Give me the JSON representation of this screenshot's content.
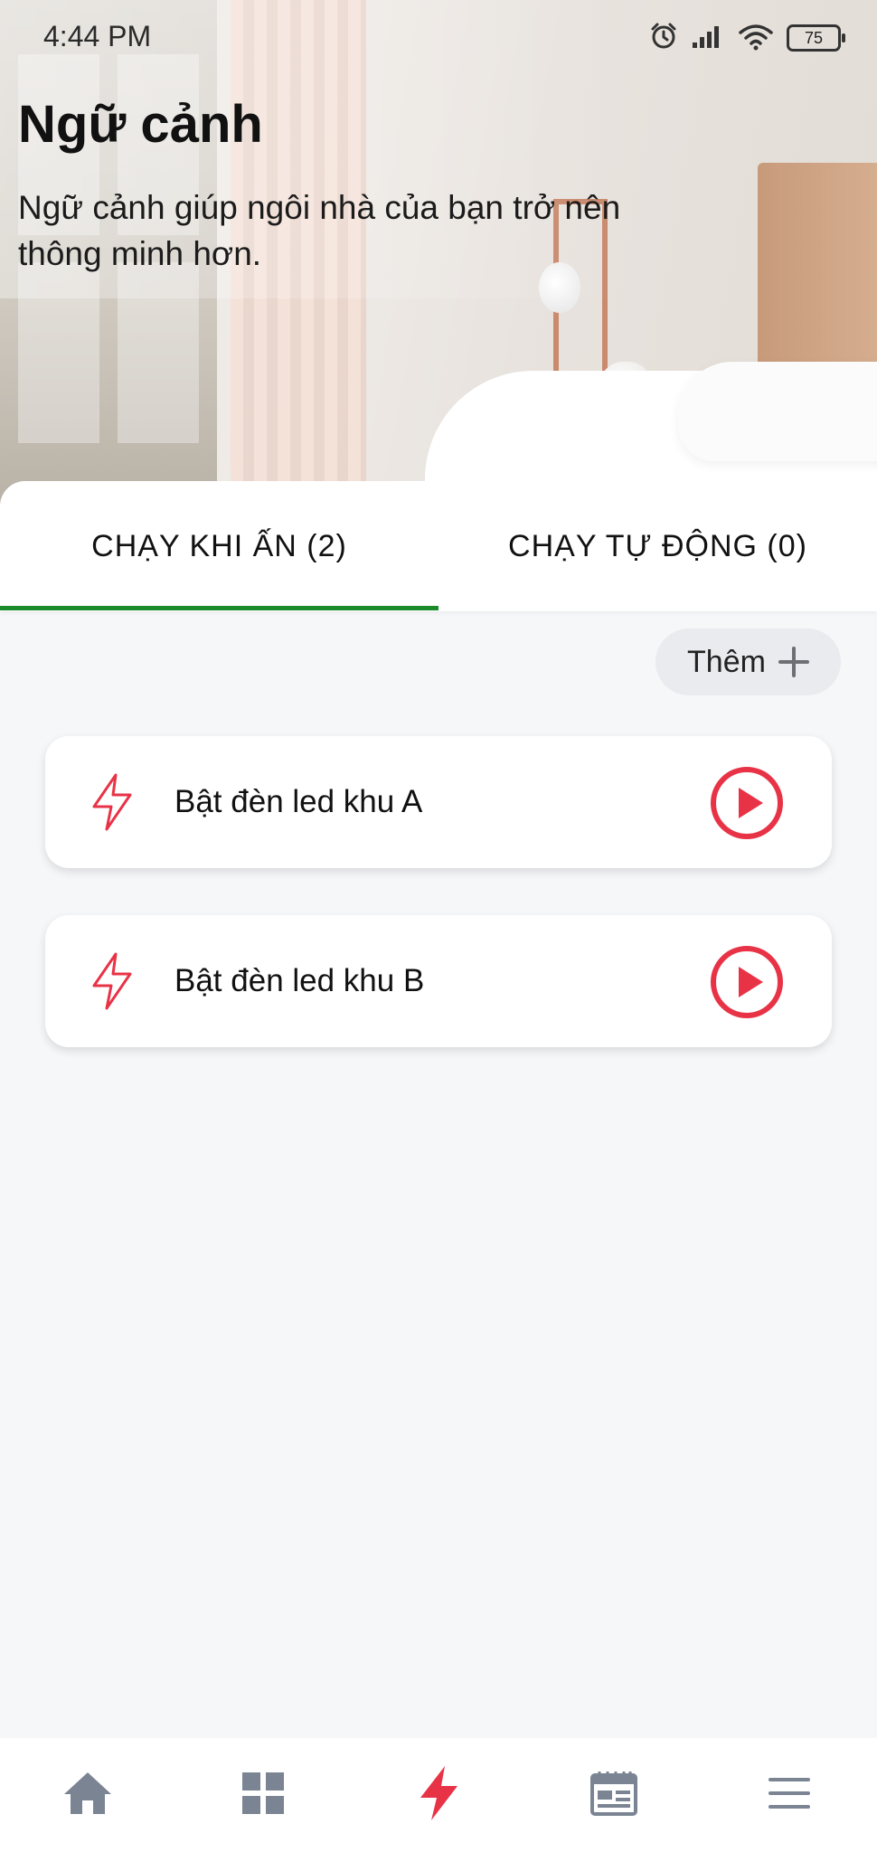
{
  "status_bar": {
    "time": "4:44 PM",
    "battery": "75",
    "icons": [
      "alarm-icon",
      "signal-icon",
      "wifi-icon",
      "battery-icon"
    ]
  },
  "header": {
    "title": "Ngữ cảnh",
    "subtitle": "Ngữ cảnh giúp ngôi nhà của bạn trở nên thông minh hơn."
  },
  "tabs": [
    {
      "label": "CHẠY KHI ẤN (2)",
      "active": true
    },
    {
      "label": "CHẠY TỰ ĐỘNG (0)",
      "active": false
    }
  ],
  "add_button": {
    "label": "Thêm",
    "icon": "plus-icon"
  },
  "scenes": [
    {
      "name": "Bật đèn led khu A",
      "icon": "lightning-icon",
      "action_icon": "play-icon"
    },
    {
      "name": "Bật đèn led khu B",
      "icon": "lightning-icon",
      "action_icon": "play-icon"
    }
  ],
  "bottom_nav": [
    {
      "icon": "home-icon",
      "active": false
    },
    {
      "icon": "grid-icon",
      "active": false
    },
    {
      "icon": "lightning-icon",
      "active": true
    },
    {
      "icon": "calendar-icon",
      "active": false
    },
    {
      "icon": "menu-icon",
      "active": false
    }
  ],
  "colors": {
    "accent": "#e83347",
    "tab_indicator": "#1a8a2a",
    "nav_inactive": "#7b8492",
    "background": "#f6f7f9"
  }
}
